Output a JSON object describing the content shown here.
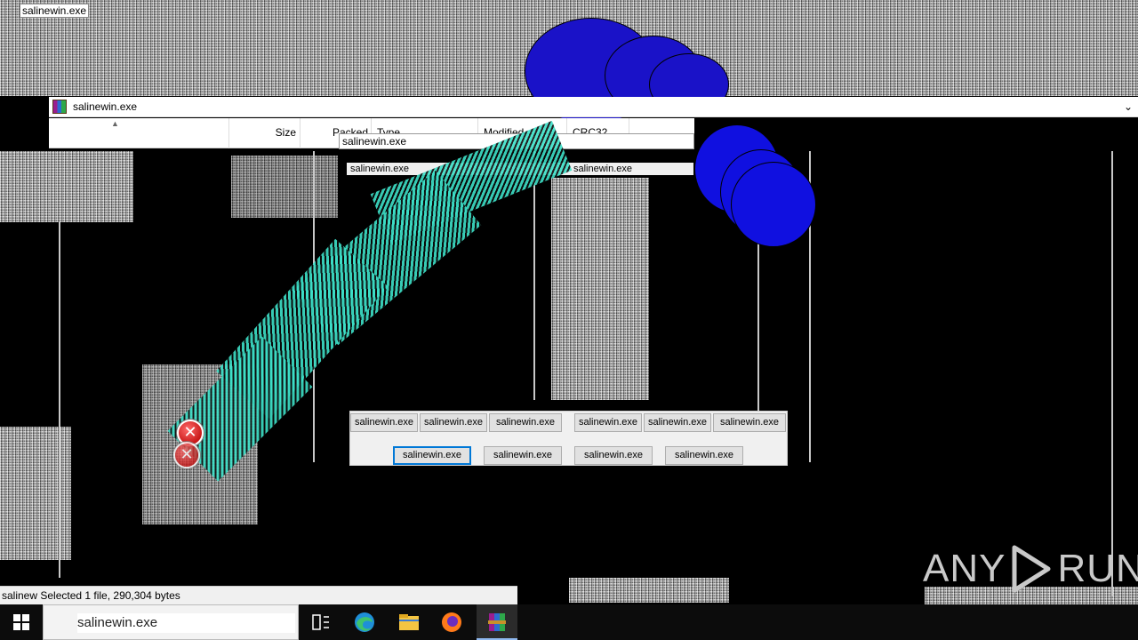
{
  "desktop": {
    "title_tag": "salinewin.exe"
  },
  "window": {
    "title": "salinewin.exe",
    "columns": [
      "Size",
      "Packed",
      "Type",
      "Modified",
      "CRC32"
    ],
    "rename_field_value": "salinewin.exe",
    "selected_row": {
      "name": "salinewin.exe",
      "type": "salinewin.exe"
    }
  },
  "dialog": {
    "row1_buttons": [
      "salinewin.exe",
      "salinewin.exe",
      "salinewin.exe",
      "salinewin.exe",
      "salinewin.exe",
      "salinewin.exe"
    ],
    "row2_buttons": [
      "salinewin.exe",
      "salinewin.exe",
      "salinewin.exe",
      "salinewin.exe"
    ]
  },
  "status_bar": {
    "text": "salinew Selected 1 file, 290,304 bytes"
  },
  "watermark": {
    "left": "ANY",
    "right": "RUN"
  },
  "taskbar": {
    "search_value": "salinewin.exe",
    "icons": [
      "windows-start-icon",
      "task-view-icon",
      "edge-icon",
      "file-explorer-icon",
      "firefox-icon",
      "winrar-icon"
    ]
  }
}
